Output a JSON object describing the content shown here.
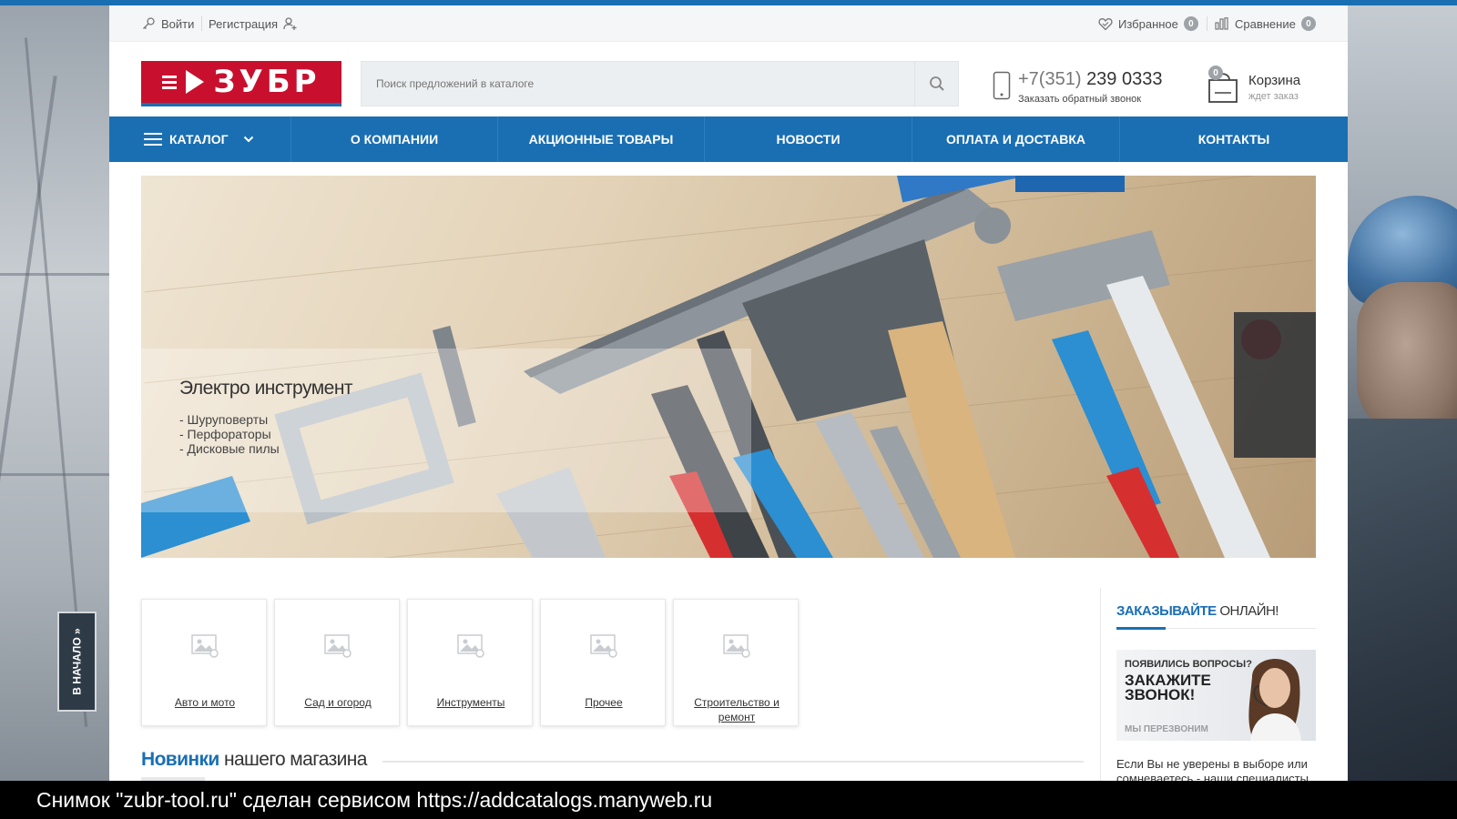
{
  "topbar": {
    "login": "Войти",
    "register": "Регистрация",
    "favorites": "Избранное",
    "favorites_count": "0",
    "compare": "Сравнение",
    "compare_count": "0"
  },
  "header": {
    "logo_text": "ЗУБР",
    "search_placeholder": "Поиск предложений в каталоге",
    "phone_code": "+7(351)",
    "phone_number": "239 0333",
    "callback": "Заказать обратный звонок",
    "cart_count": "0",
    "cart_title": "Корзина",
    "cart_sub": "ждет заказ"
  },
  "nav": {
    "catalog": "КАТАЛОГ",
    "items": [
      "О КОМПАНИИ",
      "АКЦИОННЫЕ ТОВАРЫ",
      "НОВОСТИ",
      "ОПЛАТА И ДОСТАВКА",
      "КОНТАКТЫ"
    ]
  },
  "slider": {
    "title": "Электро инструмент",
    "items": [
      "- Шуруповерты",
      "- Перфораторы",
      "- Дисковые пилы"
    ]
  },
  "categories": [
    "Авто и мото",
    "Сад и огород",
    "Инструменты",
    "Прочее",
    "Строительство и ремонт"
  ],
  "news": {
    "accent": "Новинки",
    "rest": "нашего магазина"
  },
  "sidebar": {
    "title_accent": "ЗАКАЗЫВАЙТЕ",
    "title_rest": "ОНЛАЙН!",
    "banner_question": "ПОЯВИЛИСЬ ВОПРОСЫ?",
    "banner_cta": "ЗАКАЖИТЕ ЗВОНОК!",
    "banner_note": "МЫ ПЕРЕЗВОНИМ",
    "text": "Если Вы не уверены в выборе или сомневаетесь - наши специалисты"
  },
  "to_top": "В НАЧАЛО",
  "watermark": "Снимок \"zubr-tool.ru\" сделан сервисом https://addcatalogs.manyweb.ru",
  "colors": {
    "brand_blue": "#1a6fb3",
    "brand_red": "#c8102e"
  }
}
